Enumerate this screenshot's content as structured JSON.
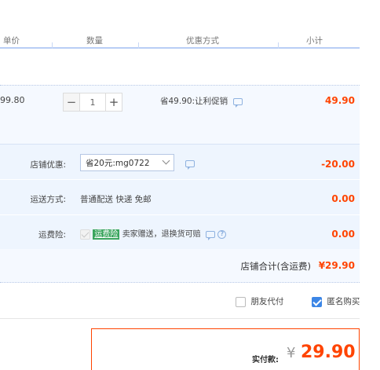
{
  "headers": {
    "unit_price": "单价",
    "quantity": "数量",
    "discount": "优惠方式",
    "subtotal": "小计"
  },
  "item": {
    "unit_price": "99.80",
    "quantity": "1",
    "minus": "−",
    "plus": "+",
    "promo": "省49.90:让利促销",
    "subtotal": "49.90"
  },
  "shop": {
    "coupon_label": "店铺优惠:",
    "coupon_value": "省20元:mg0722",
    "coupon_amount": "-20.00",
    "shipping_label": "运送方式:",
    "shipping_value": "普通配送 快递 免邮",
    "shipping_amount": "0.00",
    "insurance_label": "运费险:",
    "insurance_tag": "运费险",
    "insurance_text": "卖家赠送，退换货可赔",
    "help_glyph": "?",
    "insurance_amount": "0.00",
    "total_label": "店铺合计(含运费)",
    "total_amount": "¥29.90"
  },
  "options": {
    "friend_pay": "朋友代付",
    "anonymous": "匿名购买",
    "anonymous_checked": true,
    "friend_pay_checked": false
  },
  "payment": {
    "label": "实付款:",
    "currency": "¥",
    "amount": "29.90"
  },
  "colors": {
    "accent": "#ff4400",
    "blue": "#3c86e6",
    "header_line": "#b9cef5"
  }
}
